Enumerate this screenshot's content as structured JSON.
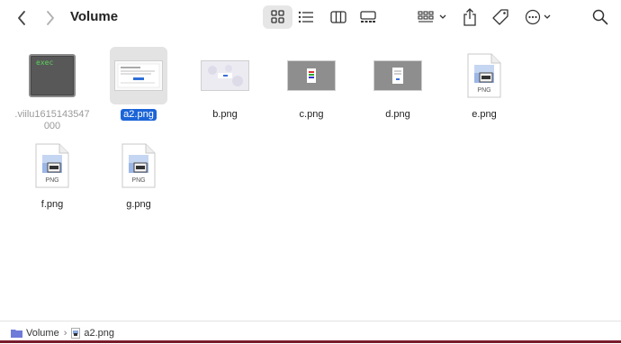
{
  "window": {
    "title": "Volume"
  },
  "toolbar": {
    "back_icon": "chevron-left-icon",
    "forward_icon": "chevron-right-icon",
    "view_modes": [
      "icon-view",
      "list-view",
      "column-view",
      "gallery-view"
    ],
    "actions": [
      "group-icon",
      "share-icon",
      "tag-icon",
      "more-icon",
      "search-icon"
    ]
  },
  "files": [
    {
      "name": ".viilu1615143547000",
      "kind": "exec",
      "badge": "exec",
      "hidden": true
    },
    {
      "name": "a2.png",
      "kind": "screenshot",
      "selected": true
    },
    {
      "name": "b.png",
      "kind": "screenshot"
    },
    {
      "name": "c.png",
      "kind": "screenshot"
    },
    {
      "name": "d.png",
      "kind": "screenshot"
    },
    {
      "name": "e.png",
      "kind": "png-doc",
      "badge": "PNG"
    },
    {
      "name": "f.png",
      "kind": "png-doc",
      "badge": "PNG"
    },
    {
      "name": "g.png",
      "kind": "png-doc",
      "badge": "PNG"
    }
  ],
  "pathbar": {
    "items": [
      {
        "label": "Volume",
        "icon": "folder-icon"
      },
      {
        "label": "a2.png",
        "icon": "image-file-icon"
      }
    ],
    "separator": "›"
  },
  "colors": {
    "selection": "#1b64d8",
    "folder": "#6e7bd8"
  }
}
